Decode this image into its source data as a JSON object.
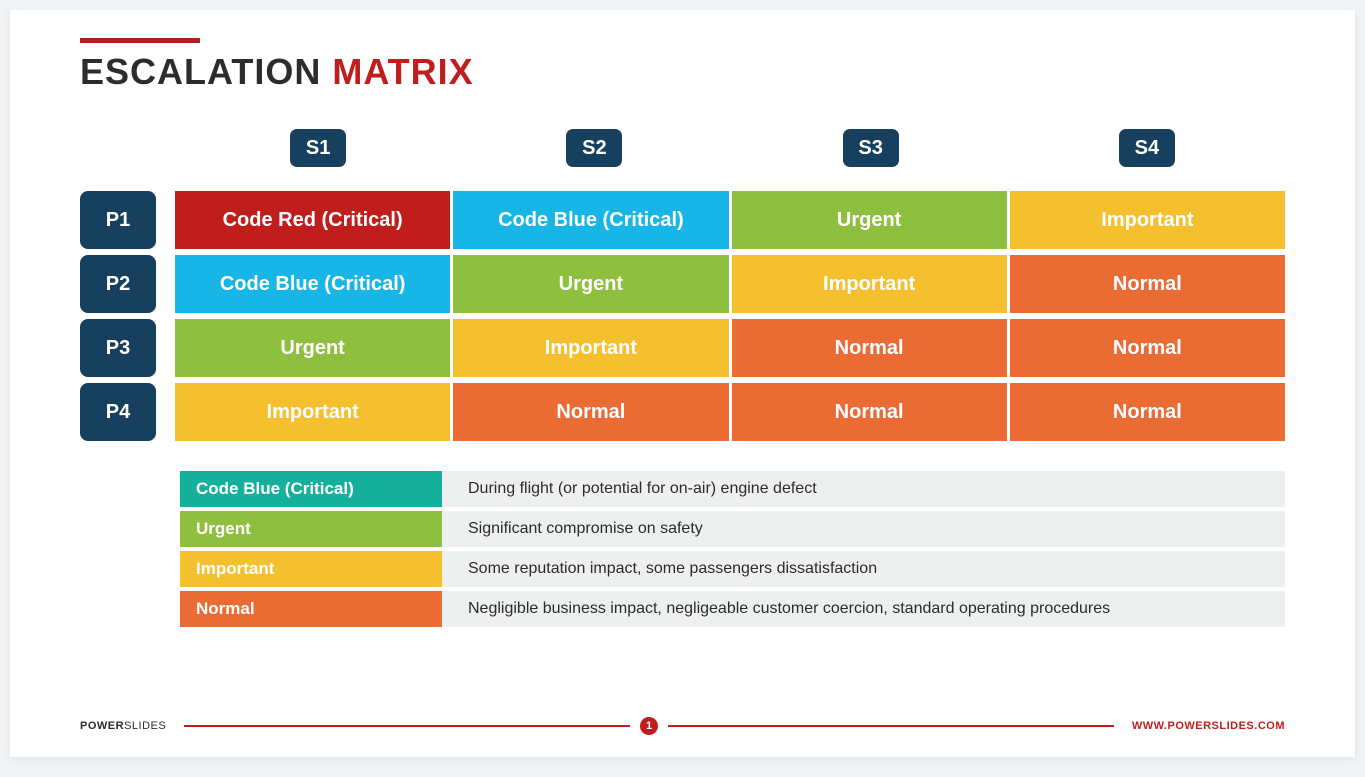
{
  "title": {
    "part1": "ESCALATION ",
    "part2": "MATRIX"
  },
  "colors": {
    "coderedbg": "#c01d1d",
    "codebluebg": "#17b6e6",
    "urgentbg": "#8fbf3e",
    "importantbg": "#f5c02e",
    "normalbg": "#eb6b35",
    "codebluecritical_legend": "#15b09b",
    "navy": "#16405d",
    "red": "#c01d1d"
  },
  "columns": [
    "S1",
    "S2",
    "S3",
    "S4"
  ],
  "rows": [
    "P1",
    "P2",
    "P3",
    "P4"
  ],
  "cells": [
    [
      {
        "label": "Code Red (Critical)",
        "color": "#c01d1d"
      },
      {
        "label": "Code Blue (Critical)",
        "color": "#17b6e6"
      },
      {
        "label": "Urgent",
        "color": "#8fbf3e"
      },
      {
        "label": "Important",
        "color": "#f5c02e"
      }
    ],
    [
      {
        "label": "Code Blue (Critical)",
        "color": "#17b6e6"
      },
      {
        "label": "Urgent",
        "color": "#8fbf3e"
      },
      {
        "label": "Important",
        "color": "#f5c02e"
      },
      {
        "label": "Normal",
        "color": "#eb6b35"
      }
    ],
    [
      {
        "label": "Urgent",
        "color": "#8fbf3e"
      },
      {
        "label": "Important",
        "color": "#f5c02e"
      },
      {
        "label": "Normal",
        "color": "#eb6b35"
      },
      {
        "label": "Normal",
        "color": "#eb6b35"
      }
    ],
    [
      {
        "label": "Important",
        "color": "#f5c02e"
      },
      {
        "label": "Normal",
        "color": "#eb6b35"
      },
      {
        "label": "Normal",
        "color": "#eb6b35"
      },
      {
        "label": "Normal",
        "color": "#eb6b35"
      }
    ]
  ],
  "legend": [
    {
      "label": "Code Blue (Critical)",
      "color": "#15b09b",
      "desc": "During flight (or potential for on-air) engine defect"
    },
    {
      "label": "Urgent",
      "color": "#8fbf3e",
      "desc": "Significant compromise on safety"
    },
    {
      "label": "Important",
      "color": "#f5c02e",
      "desc": "Some reputation impact, some passengers dissatisfaction"
    },
    {
      "label": "Normal",
      "color": "#eb6b35",
      "desc": "Negligible business impact, negligeable customer coercion, standard operating procedures"
    }
  ],
  "footer": {
    "brand_bold": "POWER",
    "brand_rest": "SLIDES",
    "page": "1",
    "url": "WWW.POWERSLIDES.COM"
  }
}
